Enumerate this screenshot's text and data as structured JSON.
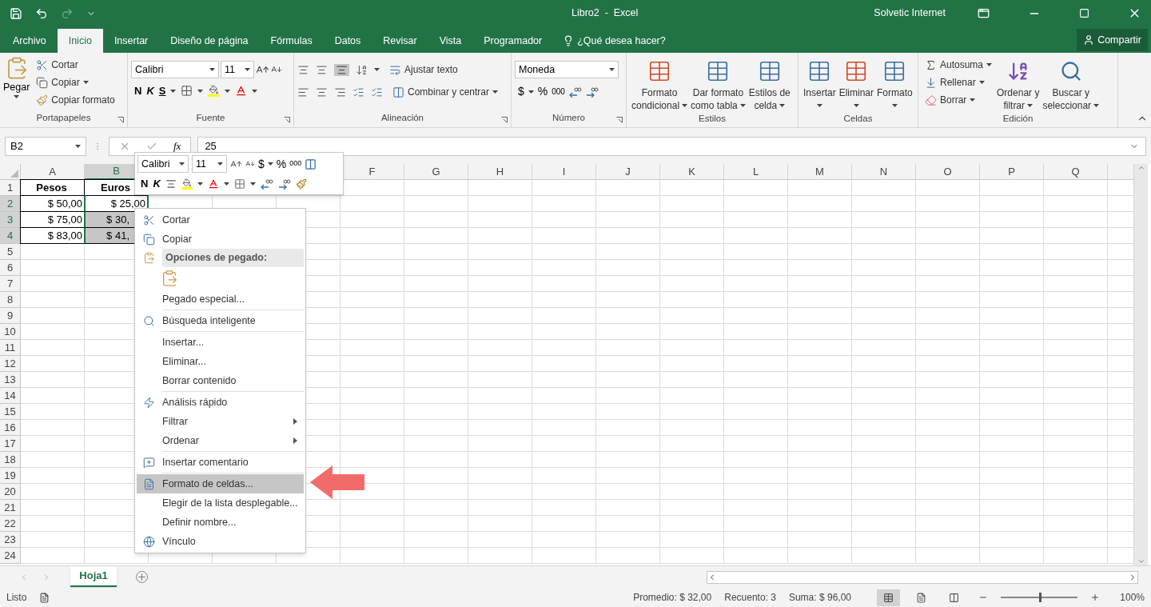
{
  "title_bar": {
    "title": "Libro2  -  Excel",
    "user": "Solvetic Internet"
  },
  "ribbon_tabs": [
    {
      "label": "Archivo",
      "selected": false
    },
    {
      "label": "Inicio",
      "selected": true
    },
    {
      "label": "Insertar",
      "selected": false
    },
    {
      "label": "Diseño de página",
      "selected": false
    },
    {
      "label": "Fórmulas",
      "selected": false
    },
    {
      "label": "Datos",
      "selected": false
    },
    {
      "label": "Revisar",
      "selected": false
    },
    {
      "label": "Vista",
      "selected": false
    },
    {
      "label": "Programador",
      "selected": false
    }
  ],
  "tell_me": "¿Qué desea hacer?",
  "share": "Compartir",
  "clipboard": {
    "label": "Portapapeles",
    "paste": "Pegar",
    "cut": "Cortar",
    "copy": "Copiar",
    "format_painter": "Copiar formato"
  },
  "font": {
    "label": "Fuente",
    "font_name": "Calibri",
    "font_size": "11",
    "bold": "N",
    "italic": "K",
    "underline": "S"
  },
  "alignment": {
    "label": "Alineación",
    "wrap": "Ajustar texto",
    "merge": "Combinar y centrar"
  },
  "number": {
    "label": "Número",
    "format": "Moneda",
    "currency": "$",
    "percent": "%",
    "thousands": "000"
  },
  "styles": {
    "label": "Estilos",
    "buttons": [
      [
        "Formato",
        "condicional"
      ],
      [
        "Dar formato",
        "como tabla"
      ],
      [
        "Estilos de",
        "celda"
      ]
    ]
  },
  "cells": {
    "label": "Celdas",
    "buttons": [
      "Insertar",
      "Eliminar",
      "Formato"
    ]
  },
  "editing": {
    "label": "Edición",
    "autosum": "Autosuma",
    "fill": "Rellenar",
    "clear": "Borrar",
    "sort": [
      "Ordenar y",
      "filtrar"
    ],
    "find": [
      "Buscar y",
      "seleccionar"
    ]
  },
  "formula_bar": {
    "name_box": "B2",
    "function_symbol": "fx",
    "value": "25"
  },
  "sheet": {
    "columns_left": [
      {
        "label": "A",
        "selected": false
      },
      {
        "label": "B",
        "selected": true
      }
    ],
    "columns_right": [
      {
        "label": "F",
        "selected": false
      },
      {
        "label": "G",
        "selected": false
      },
      {
        "label": "H",
        "selected": false
      },
      {
        "label": "I",
        "selected": false
      },
      {
        "label": "J",
        "selected": false
      },
      {
        "label": "K",
        "selected": false
      },
      {
        "label": "L",
        "selected": false
      },
      {
        "label": "M",
        "selected": false
      },
      {
        "label": "N",
        "selected": false
      },
      {
        "label": "O",
        "selected": false
      },
      {
        "label": "P",
        "selected": false
      },
      {
        "label": "Q",
        "selected": false
      }
    ],
    "rows": [
      {
        "number": "1",
        "selected": false,
        "cells": [
          {
            "text": "Pesos",
            "bold": true,
            "selected": false,
            "active": false,
            "covered": false
          },
          {
            "text": "Euros",
            "bold": true,
            "selected": false,
            "active": false,
            "covered": false
          }
        ]
      },
      {
        "number": "2",
        "selected": true,
        "cells": [
          {
            "text": "$ 50,00",
            "bold": false,
            "selected": false,
            "active": false,
            "covered": false
          },
          {
            "text": "$ 25,00",
            "bold": false,
            "selected": false,
            "active": true,
            "covered": false
          }
        ]
      },
      {
        "number": "3",
        "selected": true,
        "cells": [
          {
            "text": "$ 75,00",
            "bold": false,
            "selected": false,
            "active": false,
            "covered": false
          },
          {
            "text": "$ 30,",
            "bold": false,
            "selected": true,
            "active": false,
            "covered": true
          }
        ]
      },
      {
        "number": "4",
        "selected": true,
        "cells": [
          {
            "text": "$ 83,00",
            "bold": false,
            "selected": false,
            "active": false,
            "covered": false
          },
          {
            "text": "$ 41,",
            "bold": false,
            "selected": true,
            "active": false,
            "covered": true
          }
        ]
      },
      {
        "number": "5",
        "selected": false,
        "cells": []
      },
      {
        "number": "6",
        "selected": false,
        "cells": []
      },
      {
        "number": "7",
        "selected": false,
        "cells": []
      },
      {
        "number": "8",
        "selected": false,
        "cells": []
      },
      {
        "number": "9",
        "selected": false,
        "cells": []
      },
      {
        "number": "10",
        "selected": false,
        "cells": []
      },
      {
        "number": "11",
        "selected": false,
        "cells": []
      },
      {
        "number": "12",
        "selected": false,
        "cells": []
      },
      {
        "number": "13",
        "selected": false,
        "cells": []
      },
      {
        "number": "14",
        "selected": false,
        "cells": []
      },
      {
        "number": "15",
        "selected": false,
        "cells": []
      },
      {
        "number": "16",
        "selected": false,
        "cells": []
      },
      {
        "number": "17",
        "selected": false,
        "cells": []
      },
      {
        "number": "18",
        "selected": false,
        "cells": []
      },
      {
        "number": "19",
        "selected": false,
        "cells": []
      },
      {
        "number": "20",
        "selected": false,
        "cells": []
      },
      {
        "number": "21",
        "selected": false,
        "cells": []
      },
      {
        "number": "22",
        "selected": false,
        "cells": []
      },
      {
        "number": "23",
        "selected": false,
        "cells": []
      },
      {
        "number": "24",
        "selected": false,
        "cells": []
      }
    ]
  },
  "mini_toolbar": {
    "font_name": "Calibri",
    "font_size": "11",
    "bold": "N",
    "italic": "K",
    "currency": "$",
    "percent": "%",
    "thousands": "000"
  },
  "context_menu": [
    {
      "kind": "item",
      "label": "Cortar",
      "selected": false,
      "submenu": false,
      "separator_before": false
    },
    {
      "kind": "item",
      "label": "Copiar",
      "selected": false,
      "submenu": false,
      "separator_before": false
    },
    {
      "kind": "header",
      "label": "Opciones de pegado:"
    },
    {
      "kind": "paste_option"
    },
    {
      "kind": "item",
      "label": "Pegado especial...",
      "selected": false,
      "submenu": false,
      "separator_before": false
    },
    {
      "kind": "item",
      "label": "Búsqueda inteligente",
      "selected": false,
      "submenu": false,
      "separator_before": true
    },
    {
      "kind": "item",
      "label": "Insertar...",
      "selected": false,
      "submenu": false,
      "separator_before": true
    },
    {
      "kind": "item",
      "label": "Eliminar...",
      "selected": false,
      "submenu": false,
      "separator_before": false
    },
    {
      "kind": "item",
      "label": "Borrar contenido",
      "selected": false,
      "submenu": false,
      "separator_before": false
    },
    {
      "kind": "item",
      "label": "Análisis rápido",
      "selected": false,
      "submenu": false,
      "separator_before": true
    },
    {
      "kind": "item",
      "label": "Filtrar",
      "selected": false,
      "submenu": true,
      "separator_before": false
    },
    {
      "kind": "item",
      "label": "Ordenar",
      "selected": false,
      "submenu": true,
      "separator_before": false
    },
    {
      "kind": "item",
      "label": "Insertar comentario",
      "selected": false,
      "submenu": false,
      "separator_before": true
    },
    {
      "kind": "item",
      "label": "Formato de celdas...",
      "selected": true,
      "submenu": false,
      "separator_before": true
    },
    {
      "kind": "item",
      "label": "Elegir de la lista desplegable...",
      "selected": false,
      "submenu": false,
      "separator_before": false
    },
    {
      "kind": "item",
      "label": "Definir nombre...",
      "selected": false,
      "submenu": false,
      "separator_before": false
    },
    {
      "kind": "item",
      "label": "Vínculo",
      "selected": false,
      "submenu": false,
      "separator_before": false
    }
  ],
  "sheet_tabs": [
    {
      "label": "Hoja1",
      "selected": true
    }
  ],
  "status_bar": {
    "mode": "Listo",
    "average": "Promedio: $ 32,00",
    "count": "Recuento: 3",
    "sum": "Suma: $ 96,00",
    "views": [
      {
        "selected": true
      },
      {
        "selected": false
      },
      {
        "selected": false
      }
    ],
    "zoom": {
      "level": 0.5
    },
    "zoom_text": "100%"
  }
}
